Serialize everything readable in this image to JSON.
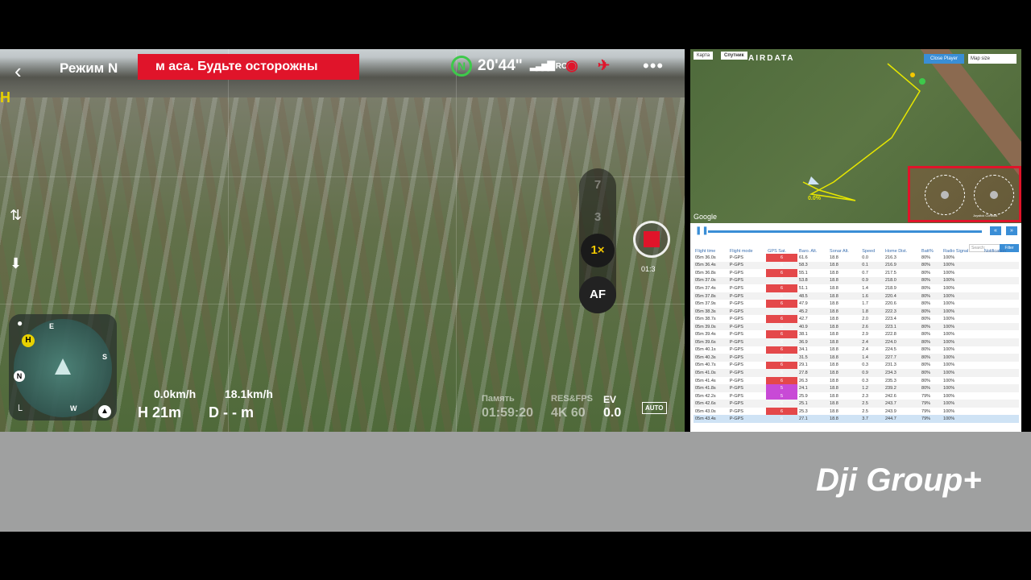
{
  "camera": {
    "back_icon": "chevron-left-icon",
    "mode_label": "Режим N",
    "warning": "м аса. Будьте осторожны",
    "battery_label": "N",
    "flight_time": "20'44\"",
    "signal_label": "RC",
    "more_label": "•••",
    "home_badge": "H",
    "zoom_levels": [
      "7",
      "3"
    ],
    "zoom_selected": "1×",
    "af_label": "AF",
    "record_time": "01:3",
    "radar": {
      "e": "E",
      "s": "S",
      "w": "W",
      "h": "H",
      "n": "N"
    },
    "horizontal_speed": "0.0km/h",
    "vertical_speed": "18.1km/h",
    "height": "H 21m",
    "distance": "D - - m",
    "memory_label": "Память",
    "memory_value": "01:59:20",
    "resfps_label": "RES&FPS",
    "resfps_value": "4K 60",
    "ev_label": "EV",
    "ev_value": "0.0",
    "auto_label": "AUTO"
  },
  "airdata": {
    "tabs": [
      "Карта",
      "Спутник"
    ],
    "logo": "AIRDATA",
    "close_player": "Close Player",
    "map_size": "Map size",
    "google": "Google",
    "search_placeholder": "Search:",
    "filter_label": "Filter",
    "columns": [
      "Flight time",
      "Flight mode",
      "GPS Sat.",
      "Baro. Alt.",
      "Sonar Alt.",
      "Speed",
      "Home Dist.",
      "Batt%",
      "Radio Signal",
      "Notification"
    ],
    "rows": [
      [
        "05m 36.0s",
        "P-GPS",
        "6",
        "61.6",
        "18.8",
        "0.0",
        "216.3",
        "80%",
        "100%"
      ],
      [
        "05m 36.4s",
        "P-GPS",
        "6",
        "58.3",
        "18.8",
        "0.1",
        "216.9",
        "80%",
        "100%"
      ],
      [
        "05m 36.8s",
        "P-GPS",
        "6",
        "55.1",
        "18.8",
        "0.7",
        "217.5",
        "80%",
        "100%"
      ],
      [
        "05m 37.0s",
        "P-GPS",
        "6",
        "53.8",
        "18.8",
        "0.9",
        "218.0",
        "80%",
        "100%"
      ],
      [
        "05m 37.4s",
        "P-GPS",
        "6",
        "51.1",
        "18.8",
        "1.4",
        "218.9",
        "80%",
        "100%"
      ],
      [
        "05m 37.8s",
        "P-GPS",
        "6",
        "48.5",
        "18.8",
        "1.6",
        "220.4",
        "80%",
        "100%"
      ],
      [
        "05m 37.9s",
        "P-GPS",
        "6",
        "47.9",
        "18.8",
        "1.7",
        "220.6",
        "80%",
        "100%"
      ],
      [
        "05m 38.3s",
        "P-GPS",
        "6",
        "45.2",
        "18.8",
        "1.8",
        "222.3",
        "80%",
        "100%"
      ],
      [
        "05m 38.7s",
        "P-GPS",
        "6",
        "42.7",
        "18.8",
        "2.0",
        "223.4",
        "80%",
        "100%"
      ],
      [
        "05m 39.0s",
        "P-GPS",
        "6",
        "40.9",
        "18.8",
        "2.6",
        "223.1",
        "80%",
        "100%"
      ],
      [
        "05m 39.4s",
        "P-GPS",
        "6",
        "38.1",
        "18.8",
        "2.9",
        "222.8",
        "80%",
        "100%"
      ],
      [
        "05m 39.6s",
        "P-GPS",
        "6",
        "36.9",
        "18.8",
        "2.4",
        "224.0",
        "80%",
        "100%"
      ],
      [
        "05m 40.1s",
        "P-GPS",
        "6",
        "34.1",
        "18.8",
        "2.4",
        "224.5",
        "80%",
        "100%"
      ],
      [
        "05m 40.3s",
        "P-GPS",
        "6",
        "31.5",
        "18.8",
        "1.4",
        "227.7",
        "80%",
        "100%"
      ],
      [
        "05m 40.7s",
        "P-GPS",
        "6",
        "29.1",
        "18.8",
        "0.3",
        "231.3",
        "80%",
        "100%"
      ],
      [
        "05m 41.0s",
        "P-GPS",
        "6",
        "27.8",
        "18.8",
        "0.9",
        "234.3",
        "80%",
        "100%"
      ],
      [
        "05m 41.4s",
        "P-GPS",
        "6",
        "26.3",
        "18.8",
        "0.3",
        "235.3",
        "80%",
        "100%"
      ],
      [
        "05m 41.8s",
        "P-GPS",
        "5",
        "24.1",
        "18.8",
        "1.2",
        "239.2",
        "80%",
        "100%"
      ],
      [
        "05m 42.2s",
        "P-GPS",
        "5",
        "25.9",
        "18.8",
        "2.3",
        "242.6",
        "79%",
        "100%"
      ],
      [
        "05m 42.6s",
        "P-GPS",
        "6",
        "25.1",
        "18.8",
        "2.5",
        "243.7",
        "79%",
        "100%"
      ],
      [
        "05m 43.0s",
        "P-GPS",
        "6",
        "25.3",
        "18.8",
        "2.5",
        "243.9",
        "79%",
        "100%"
      ],
      [
        "05m 43.4s",
        "P-GPS",
        "6",
        "27.1",
        "18.8",
        "3.7",
        "244.7",
        "79%",
        "100%"
      ]
    ],
    "map_label_a": "0.0%",
    "stick_label": "Joystick Controls"
  },
  "brand": "Dji Group+"
}
